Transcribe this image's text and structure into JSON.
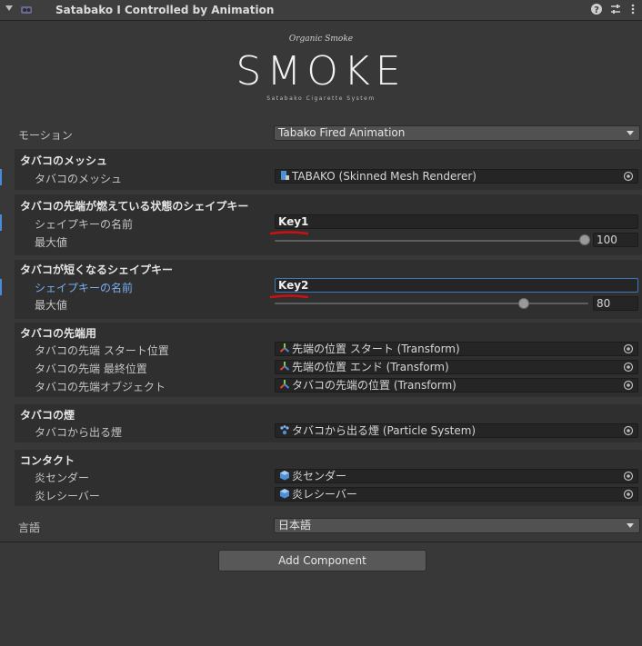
{
  "header": {
    "title": "Satabako I Controlled by Animation"
  },
  "logo": {
    "script": "Organic Smoke",
    "main": "SMOKE",
    "sub": "Satabako Cigarette System"
  },
  "motion": {
    "label": "モーション",
    "value": "Tabako Fired Animation"
  },
  "mesh_section": {
    "title": "タバコのメッシュ",
    "label": "タバコのメッシュ",
    "value": "TABAKO (Skinned Mesh Renderer)"
  },
  "burning_section": {
    "title": "タバコの先端が燃えている状態のシェイプキー",
    "name_label": "シェイプキーの名前",
    "name_value": "Key1",
    "max_label": "最大値",
    "max_value": "100",
    "max_fraction": 1.0
  },
  "shorten_section": {
    "title": "タバコが短くなるシェイプキー",
    "name_label": "シェイプキーの名前",
    "name_value": "Key2",
    "max_label": "最大値",
    "max_value": "80",
    "max_fraction": 0.8
  },
  "tip_section": {
    "title": "タバコの先端用",
    "rows": [
      {
        "label": "タバコの先端 スタート位置",
        "value": "先端の位置 スタート (Transform)"
      },
      {
        "label": "タバコの先端 最終位置",
        "value": "先端の位置 エンド (Transform)"
      },
      {
        "label": "タバコの先端オブジェクト",
        "value": "タバコの先端の位置 (Transform)"
      }
    ]
  },
  "smoke_section": {
    "title": "タバコの煙",
    "label": "タバコから出る煙",
    "value": "タバコから出る煙 (Particle System)"
  },
  "contact_section": {
    "title": "コンタクト",
    "rows": [
      {
        "label": "炎センダー",
        "value": "炎センダー"
      },
      {
        "label": "炎レシーバー",
        "value": "炎レシーバー"
      }
    ]
  },
  "language": {
    "label": "言語",
    "value": "日本語"
  },
  "add_component": {
    "label": "Add Component"
  },
  "colors": {
    "background": "#383838",
    "accent": "#4a8ad8",
    "annotation": "#d01010"
  }
}
